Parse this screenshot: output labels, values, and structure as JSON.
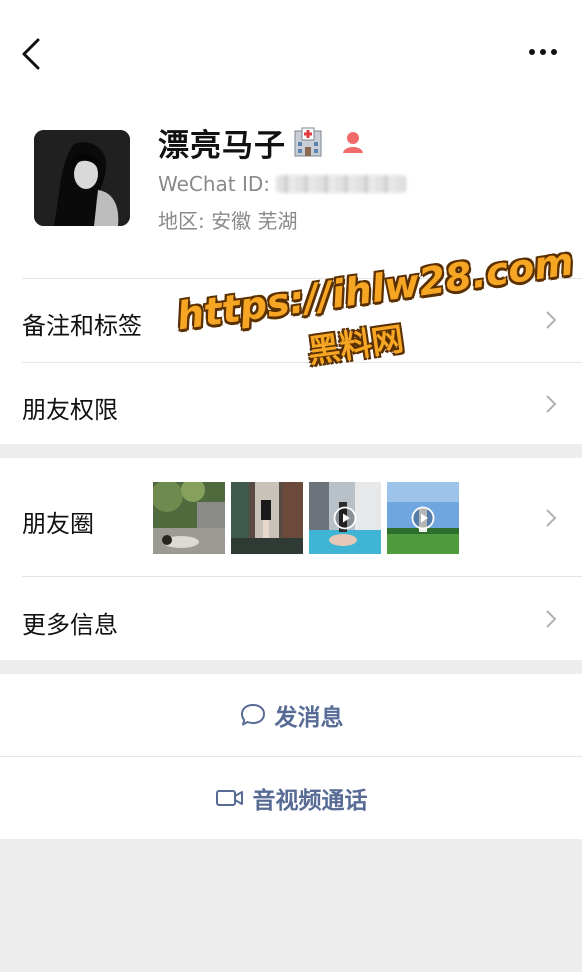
{
  "profile": {
    "name": "漂亮马子",
    "wechat_id_label": "WeChat ID:",
    "region": "地区: 安徽 芜湖"
  },
  "menu": {
    "notes_tags": "备注和标签",
    "friend_permissions": "朋友权限",
    "moments": "朋友圈",
    "more_info": "更多信息"
  },
  "actions": {
    "send_message": "发消息",
    "video_call": "音视频通话"
  },
  "watermark": {
    "url": "https://ihlw28.com",
    "brand": "黑料网"
  },
  "colors": {
    "link": "#576b95",
    "background": "#ededed",
    "watermark": "#f6a623"
  }
}
